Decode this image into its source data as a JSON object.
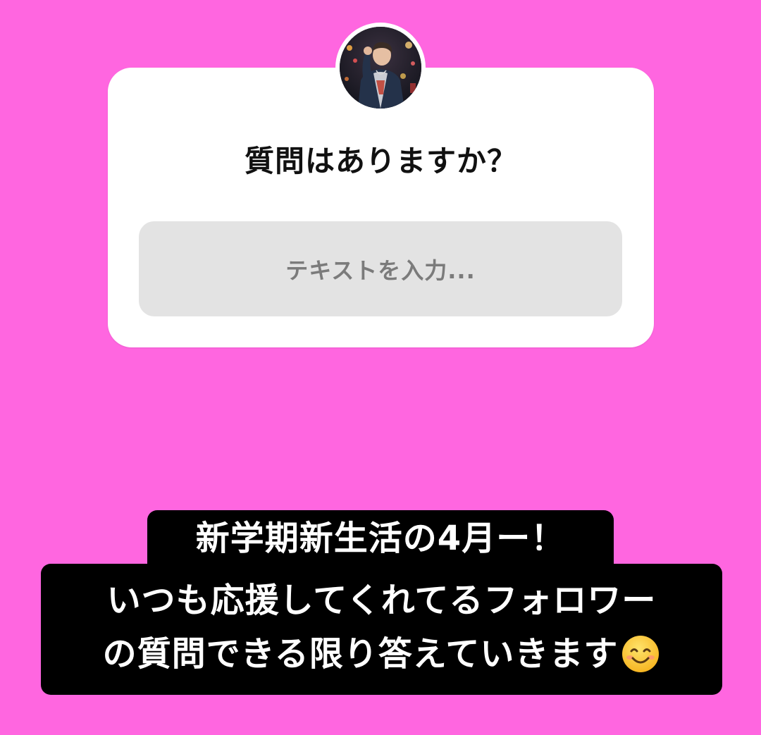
{
  "story": {
    "background_color": "#ff66e0"
  },
  "question_sticker": {
    "question_text": "質問はありますか？",
    "input_placeholder": "テキストを入力...",
    "avatar_icon": "profile-photo"
  },
  "caption": {
    "line1": "新学期新生活の4月ー！",
    "line2": "いつも応援してくれてるフォロワー",
    "line3": "の質問できる限り答えていきます",
    "emoji": "smiling-face-emoji"
  }
}
